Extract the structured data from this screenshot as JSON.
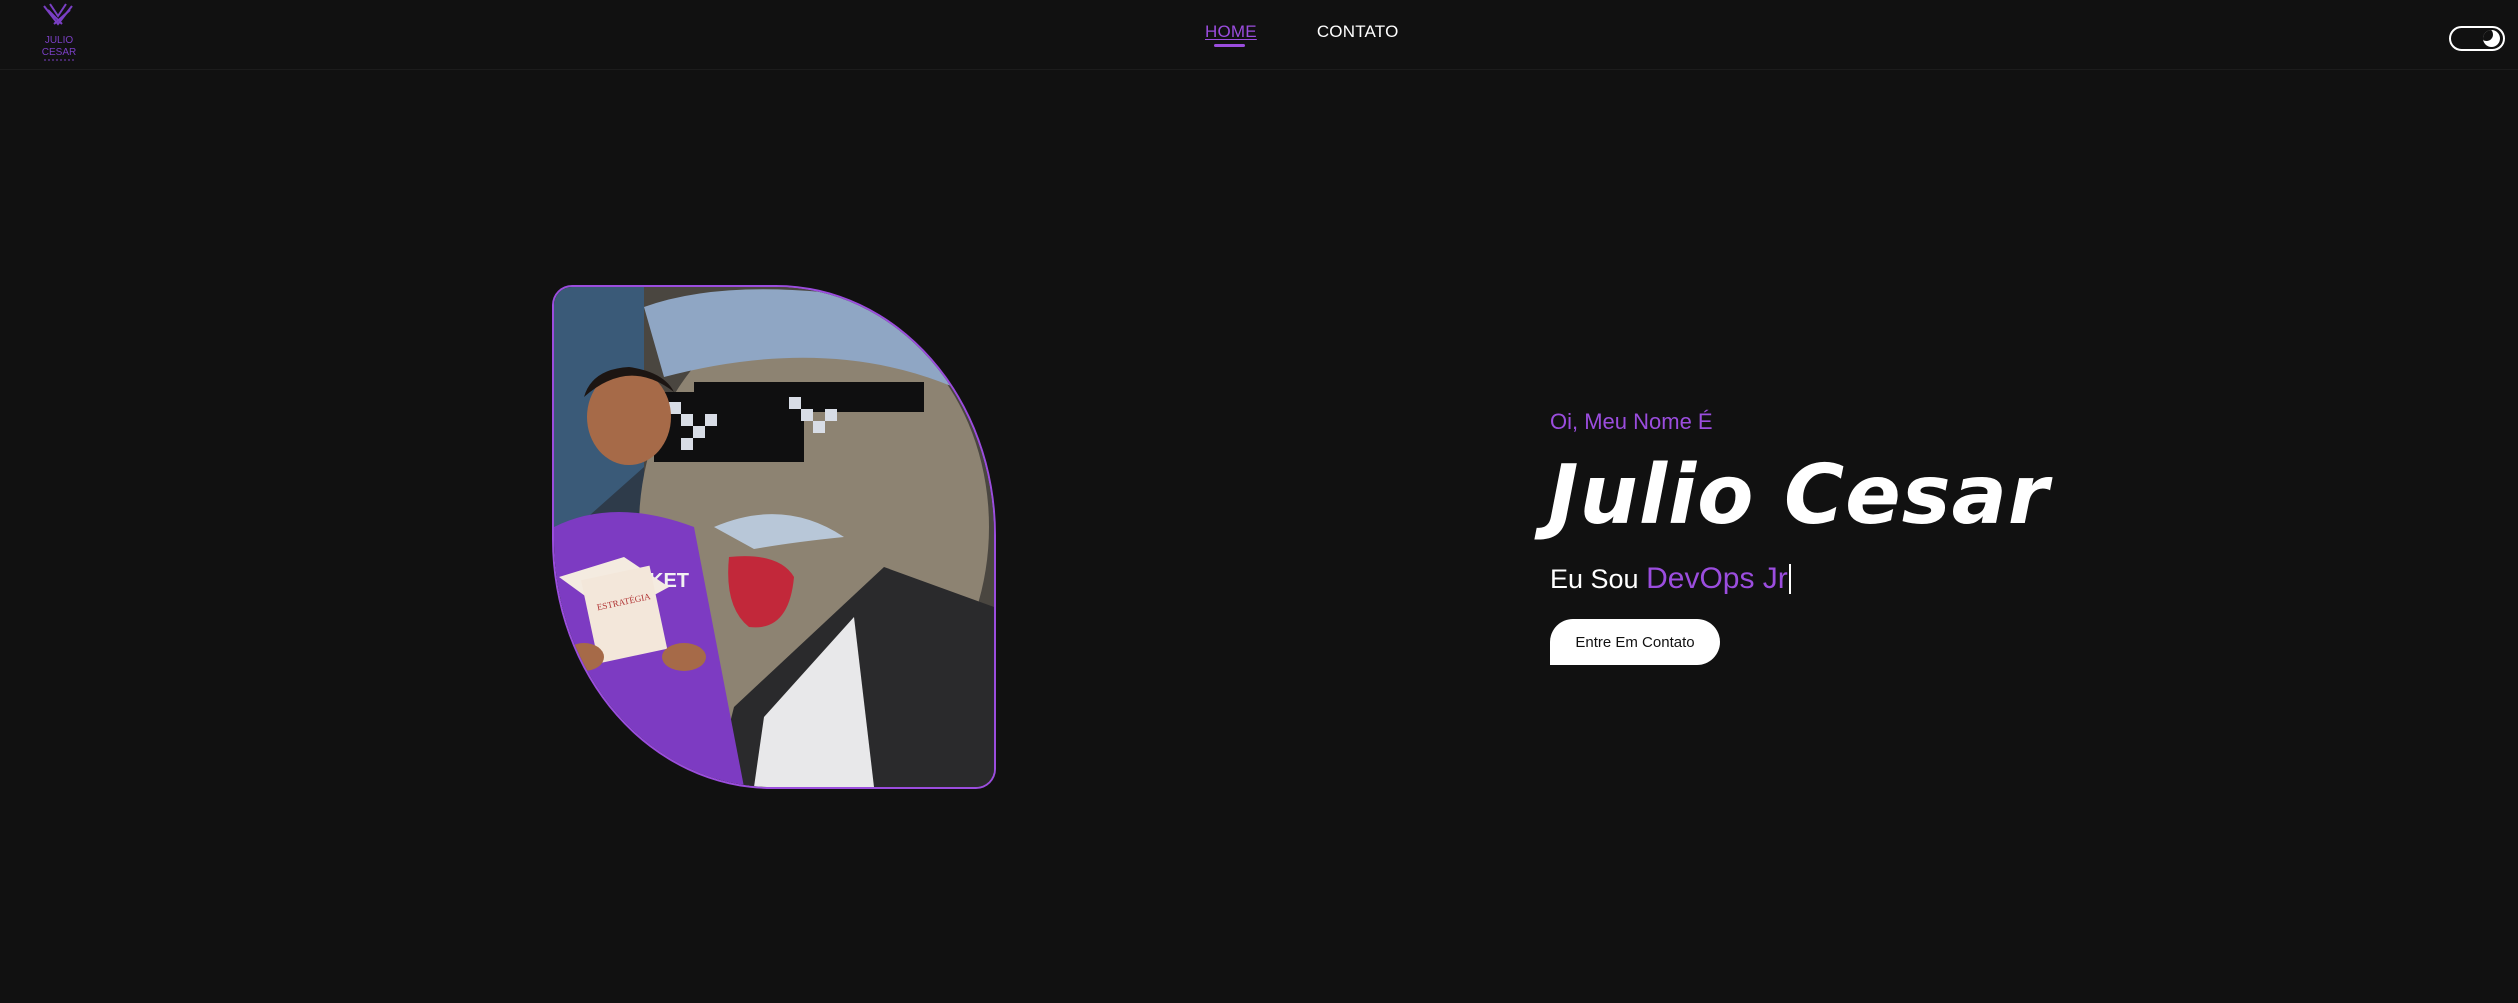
{
  "header": {
    "logo_text": "JULIO CESAR",
    "nav": [
      {
        "label": "HOME",
        "active": true
      },
      {
        "label": "CONTATO",
        "active": false
      }
    ],
    "theme_toggle": "moon-icon"
  },
  "hero": {
    "greeting": "Oi, Meu Nome É",
    "name": "Julio Cesar",
    "role_prefix": "Eu Sou",
    "role_value": "DevOps Jr",
    "cta_label": "Entre Em Contato",
    "photo": "portrait-photo"
  },
  "colors": {
    "background": "#111111",
    "accent": "#9b4dde",
    "text": "#ffffff"
  }
}
